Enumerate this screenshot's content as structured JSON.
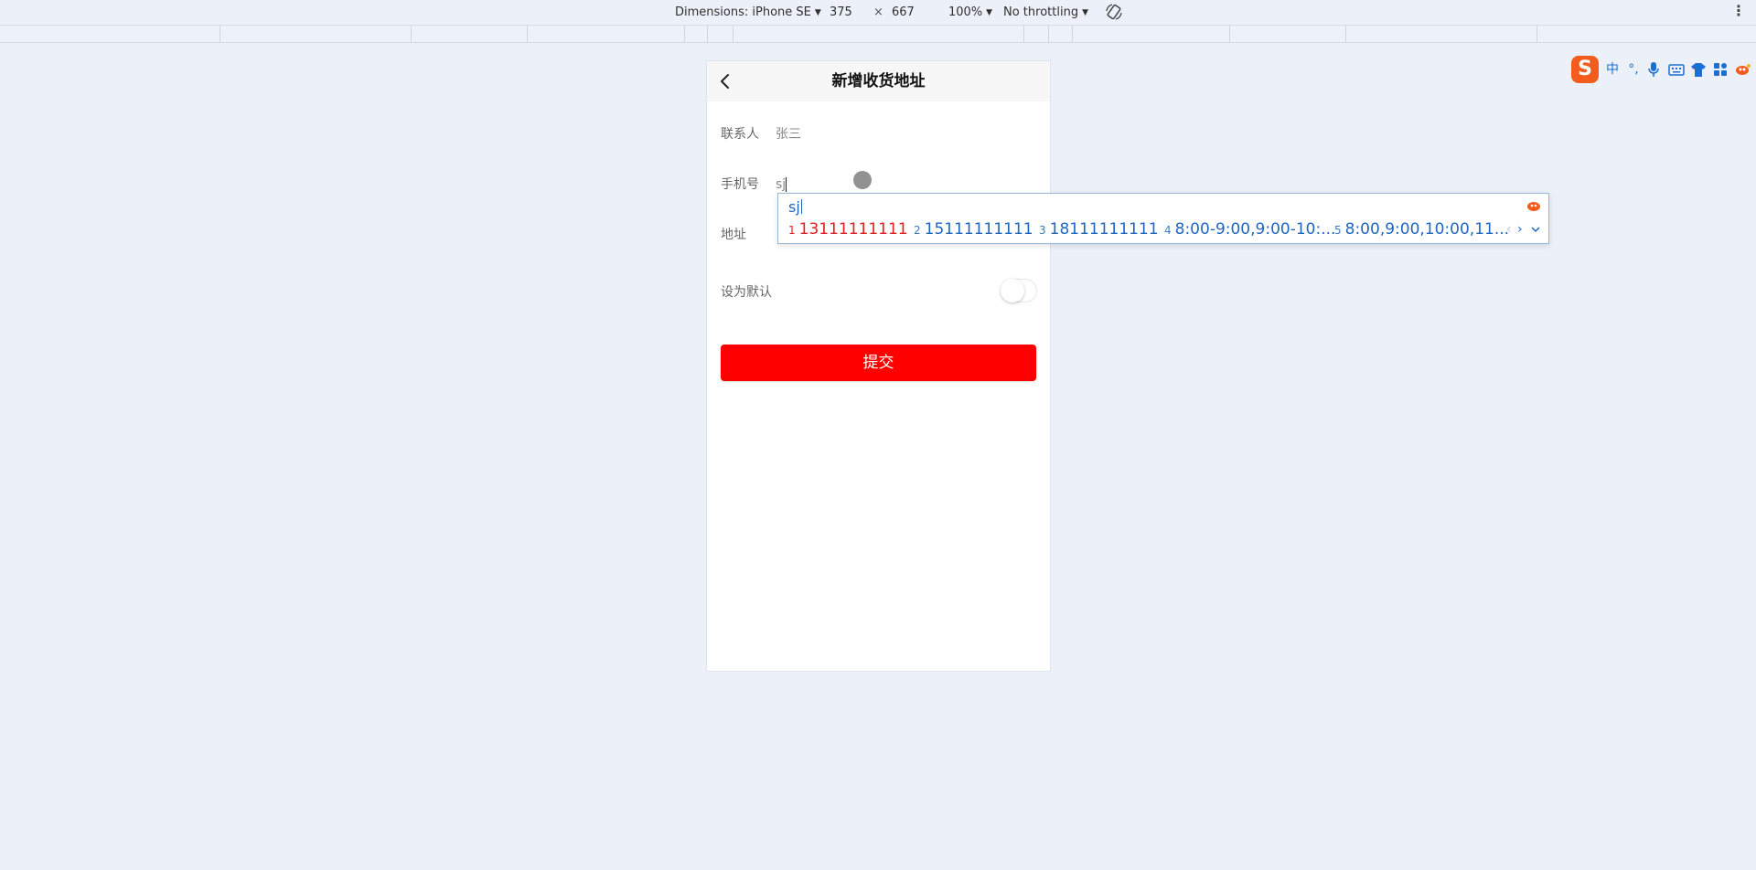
{
  "devtools": {
    "dimensions_label": "Dimensions: iPhone SE",
    "width": "375",
    "times": "×",
    "height": "667",
    "zoom": "100%",
    "throttling": "No throttling"
  },
  "page": {
    "title": "新增收货地址",
    "fields": {
      "contact_label": "联系人",
      "contact_value": "张三",
      "phone_label": "手机号",
      "phone_value": "sj",
      "address_label": "地址",
      "default_label": "设为默认"
    },
    "default_toggle_on": false,
    "submit_label": "提交",
    "colors": {
      "primary": "#ff0000",
      "nav_bg": "#f7f7f7"
    }
  },
  "ime": {
    "logo": "S",
    "mode": "中",
    "punctuation": "°,",
    "composition": "sj",
    "candidates": [
      {
        "index": "1",
        "text": "13111111111"
      },
      {
        "index": "2",
        "text": "15111111111"
      },
      {
        "index": "3",
        "text": "18111111111"
      },
      {
        "index": "4",
        "text": "8:00-9:00,9:00-10:..."
      },
      {
        "index": "5",
        "text": "8:00,9:00,10:00,11..."
      }
    ],
    "colors": {
      "active": "#e02020",
      "normal": "#1e66c0",
      "brand": "#f25d1d"
    }
  }
}
